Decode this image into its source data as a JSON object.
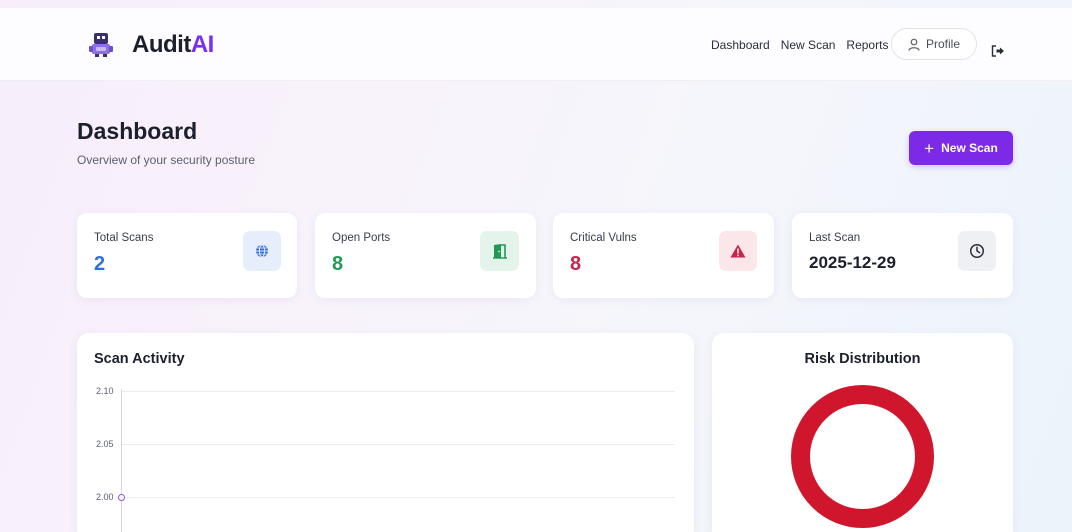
{
  "header": {
    "brand_prefix": "Audit",
    "brand_accent": "AI",
    "nav": [
      "Dashboard",
      "New Scan",
      "Reports"
    ],
    "profile_label": "Profile"
  },
  "page": {
    "title": "Dashboard",
    "subtitle": "Overview of your security posture",
    "new_scan_label": "New Scan"
  },
  "stats": [
    {
      "label": "Total Scans",
      "value": "2",
      "color": "#2d6fe0",
      "icon": "globe-icon",
      "icon_bg": "#e6eefc"
    },
    {
      "label": "Open Ports",
      "value": "8",
      "color": "#1f9a52",
      "icon": "door-icon",
      "icon_bg": "#e4f4ea"
    },
    {
      "label": "Critical Vulns",
      "value": "8",
      "color": "#c9244a",
      "icon": "warning-icon",
      "icon_bg": "#fbe6ea"
    },
    {
      "label": "Last Scan",
      "value": "2025-12-29",
      "color": "#1c1f2e",
      "icon": "clock-icon",
      "icon_bg": "#eef0f3"
    }
  ],
  "activity": {
    "title": "Scan Activity",
    "y_ticks": [
      "2.10",
      "2.05",
      "2.00"
    ]
  },
  "risk": {
    "title": "Risk Distribution",
    "ring_color": "#d0162c"
  },
  "colors": {
    "accent": "#7c2ae8"
  }
}
